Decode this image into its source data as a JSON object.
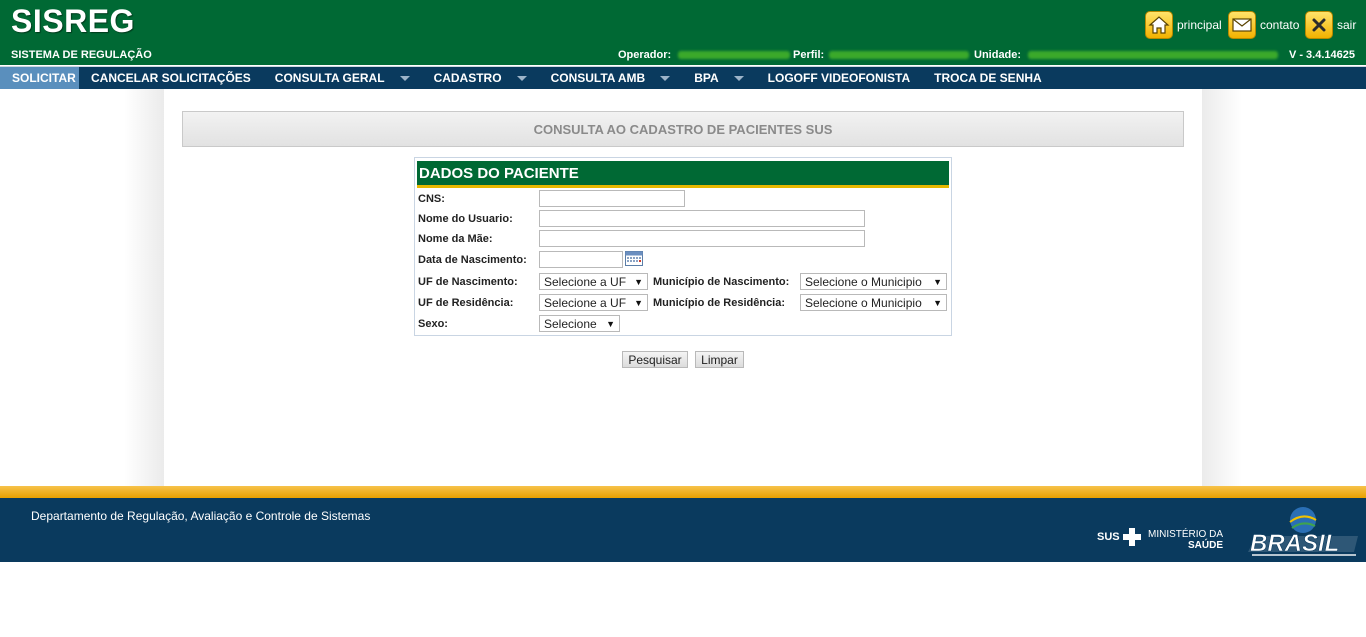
{
  "header": {
    "title": "SISREG",
    "subtitle": "SISTEMA DE REGULAÇÃO",
    "operador_label": "Operador:",
    "perfil_label": "Perfil:",
    "unidade_label": "Unidade:",
    "version": "V - 3.4.14625",
    "links": {
      "principal": "principal",
      "contato": "contato",
      "sair": "sair"
    }
  },
  "menu": {
    "items": [
      {
        "label": "SOLICITAR",
        "active": true,
        "dropdown": false
      },
      {
        "label": "CANCELAR SOLICITAÇÕES",
        "active": false,
        "dropdown": false
      },
      {
        "label": "CONSULTA GERAL",
        "active": false,
        "dropdown": true
      },
      {
        "label": "CADASTRO",
        "active": false,
        "dropdown": true
      },
      {
        "label": "CONSULTA AMB",
        "active": false,
        "dropdown": true
      },
      {
        "label": "BPA",
        "active": false,
        "dropdown": true
      },
      {
        "label": "LOGOFF VIDEOFONISTA",
        "active": false,
        "dropdown": false
      },
      {
        "label": "TROCA DE SENHA",
        "active": false,
        "dropdown": false
      }
    ]
  },
  "page": {
    "title": "CONSULTA AO CADASTRO DE PACIENTES SUS"
  },
  "form": {
    "header": "DADOS DO PACIENTE",
    "cns_label": "CNS:",
    "cns_value": "",
    "nome_usuario_label": "Nome do Usuario:",
    "nome_usuario_value": "",
    "nome_mae_label": "Nome da Mãe:",
    "nome_mae_value": "",
    "data_nascimento_label": "Data de Nascimento:",
    "data_nascimento_value": "",
    "uf_nascimento_label": "UF de Nascimento:",
    "uf_nascimento_value": "Selecione a UF",
    "municipio_nascimento_label": "Município de Nascimento:",
    "municipio_nascimento_value": "Selecione o Municipio",
    "uf_residencia_label": "UF de Residência:",
    "uf_residencia_value": "Selecione a UF",
    "municipio_residencia_label": "Município de Residência:",
    "municipio_residencia_value": "Selecione o Municipio",
    "sexo_label": "Sexo:",
    "sexo_value": "Selecione",
    "search_button": "Pesquisar",
    "clear_button": "Limpar"
  },
  "footer": {
    "text": "Departamento de Regulação, Avaliação e Controle de Sistemas",
    "sus": "SUS",
    "ministerio_line1": "MINISTÉRIO DA",
    "ministerio_line2": "SAÚDE"
  },
  "icons": {
    "home": "home-icon",
    "contact": "envelope-icon",
    "exit": "close-icon",
    "calendar": "calendar-icon",
    "dropdown": "chevron-down-icon"
  },
  "colors": {
    "header_green": "#006934",
    "menu_blue": "#0a3a5e",
    "active_menu": "#5a8fbd",
    "accent_yellow": "#e6b800"
  }
}
